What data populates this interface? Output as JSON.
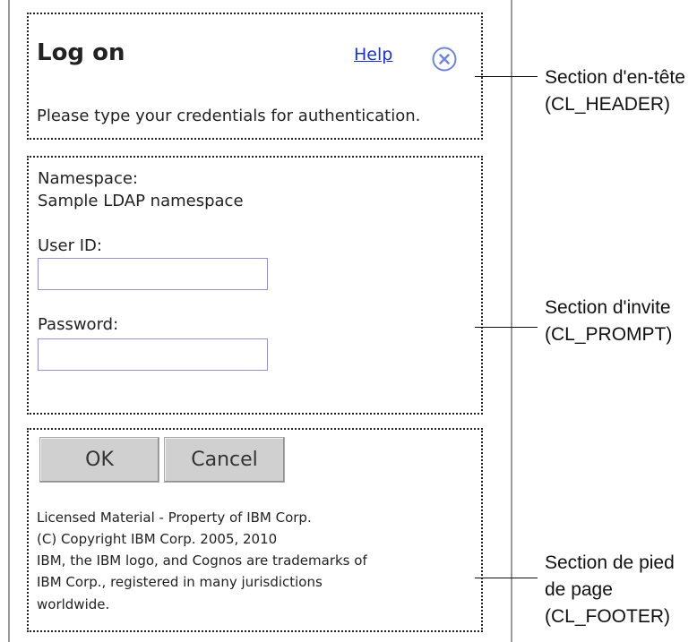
{
  "dialog": {
    "title": "Log on",
    "help_link": "Help",
    "subtitle": "Please type your credentials for authentication.",
    "close_icon": "close-circle-icon"
  },
  "prompt": {
    "namespace_label": "Namespace:",
    "namespace_value": "Sample LDAP namespace",
    "user_id_label": "User ID:",
    "user_id_value": "",
    "password_label": "Password:",
    "password_value": ""
  },
  "footer": {
    "ok_label": "OK",
    "cancel_label": "Cancel",
    "copyright_lines": [
      "Licensed Material - Property of IBM Corp.",
      "(C) Copyright IBM Corp. 2005, 2010",
      "IBM, the IBM logo, and Cognos are trademarks of",
      "IBM Corp., registered in many jurisdictions",
      "worldwide."
    ]
  },
  "callouts": {
    "header": [
      "Section d'en-tête",
      "(CL_HEADER)"
    ],
    "prompt": [
      "Section d'invite",
      "(CL_PROMPT)"
    ],
    "footer": [
      "Section de pied",
      "de page",
      "(CL_FOOTER)"
    ]
  },
  "colors": {
    "link": "#1a32c8",
    "close_icon": "#6f86d6",
    "input_border": "#9a8fd0",
    "button_bg": "#d0d0d0"
  }
}
